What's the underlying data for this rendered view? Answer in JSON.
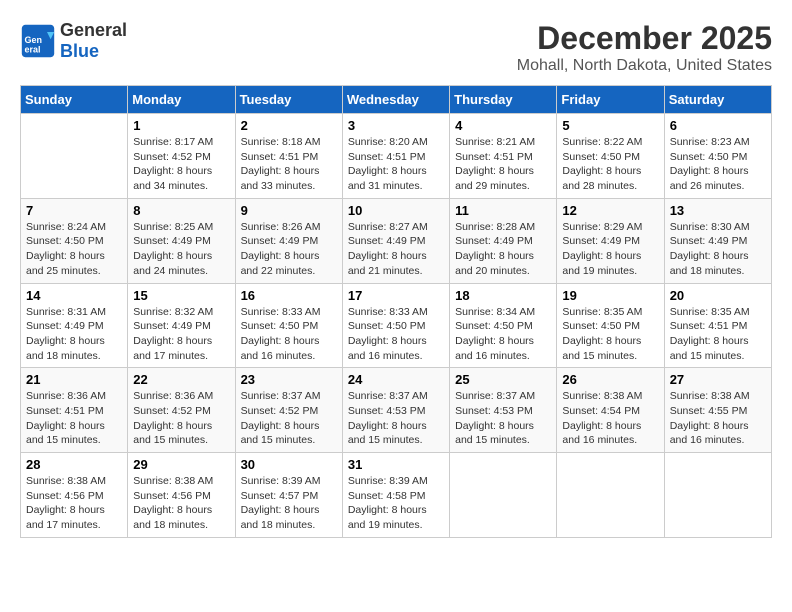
{
  "logo": {
    "general": "General",
    "blue": "Blue"
  },
  "title": "December 2025",
  "subtitle": "Mohall, North Dakota, United States",
  "days_of_week": [
    "Sunday",
    "Monday",
    "Tuesday",
    "Wednesday",
    "Thursday",
    "Friday",
    "Saturday"
  ],
  "weeks": [
    [
      {
        "day": "",
        "info": ""
      },
      {
        "day": "1",
        "info": "Sunrise: 8:17 AM\nSunset: 4:52 PM\nDaylight: 8 hours\nand 34 minutes."
      },
      {
        "day": "2",
        "info": "Sunrise: 8:18 AM\nSunset: 4:51 PM\nDaylight: 8 hours\nand 33 minutes."
      },
      {
        "day": "3",
        "info": "Sunrise: 8:20 AM\nSunset: 4:51 PM\nDaylight: 8 hours\nand 31 minutes."
      },
      {
        "day": "4",
        "info": "Sunrise: 8:21 AM\nSunset: 4:51 PM\nDaylight: 8 hours\nand 29 minutes."
      },
      {
        "day": "5",
        "info": "Sunrise: 8:22 AM\nSunset: 4:50 PM\nDaylight: 8 hours\nand 28 minutes."
      },
      {
        "day": "6",
        "info": "Sunrise: 8:23 AM\nSunset: 4:50 PM\nDaylight: 8 hours\nand 26 minutes."
      }
    ],
    [
      {
        "day": "7",
        "info": "Sunrise: 8:24 AM\nSunset: 4:50 PM\nDaylight: 8 hours\nand 25 minutes."
      },
      {
        "day": "8",
        "info": "Sunrise: 8:25 AM\nSunset: 4:49 PM\nDaylight: 8 hours\nand 24 minutes."
      },
      {
        "day": "9",
        "info": "Sunrise: 8:26 AM\nSunset: 4:49 PM\nDaylight: 8 hours\nand 22 minutes."
      },
      {
        "day": "10",
        "info": "Sunrise: 8:27 AM\nSunset: 4:49 PM\nDaylight: 8 hours\nand 21 minutes."
      },
      {
        "day": "11",
        "info": "Sunrise: 8:28 AM\nSunset: 4:49 PM\nDaylight: 8 hours\nand 20 minutes."
      },
      {
        "day": "12",
        "info": "Sunrise: 8:29 AM\nSunset: 4:49 PM\nDaylight: 8 hours\nand 19 minutes."
      },
      {
        "day": "13",
        "info": "Sunrise: 8:30 AM\nSunset: 4:49 PM\nDaylight: 8 hours\nand 18 minutes."
      }
    ],
    [
      {
        "day": "14",
        "info": "Sunrise: 8:31 AM\nSunset: 4:49 PM\nDaylight: 8 hours\nand 18 minutes."
      },
      {
        "day": "15",
        "info": "Sunrise: 8:32 AM\nSunset: 4:49 PM\nDaylight: 8 hours\nand 17 minutes."
      },
      {
        "day": "16",
        "info": "Sunrise: 8:33 AM\nSunset: 4:50 PM\nDaylight: 8 hours\nand 16 minutes."
      },
      {
        "day": "17",
        "info": "Sunrise: 8:33 AM\nSunset: 4:50 PM\nDaylight: 8 hours\nand 16 minutes."
      },
      {
        "day": "18",
        "info": "Sunrise: 8:34 AM\nSunset: 4:50 PM\nDaylight: 8 hours\nand 16 minutes."
      },
      {
        "day": "19",
        "info": "Sunrise: 8:35 AM\nSunset: 4:50 PM\nDaylight: 8 hours\nand 15 minutes."
      },
      {
        "day": "20",
        "info": "Sunrise: 8:35 AM\nSunset: 4:51 PM\nDaylight: 8 hours\nand 15 minutes."
      }
    ],
    [
      {
        "day": "21",
        "info": "Sunrise: 8:36 AM\nSunset: 4:51 PM\nDaylight: 8 hours\nand 15 minutes."
      },
      {
        "day": "22",
        "info": "Sunrise: 8:36 AM\nSunset: 4:52 PM\nDaylight: 8 hours\nand 15 minutes."
      },
      {
        "day": "23",
        "info": "Sunrise: 8:37 AM\nSunset: 4:52 PM\nDaylight: 8 hours\nand 15 minutes."
      },
      {
        "day": "24",
        "info": "Sunrise: 8:37 AM\nSunset: 4:53 PM\nDaylight: 8 hours\nand 15 minutes."
      },
      {
        "day": "25",
        "info": "Sunrise: 8:37 AM\nSunset: 4:53 PM\nDaylight: 8 hours\nand 15 minutes."
      },
      {
        "day": "26",
        "info": "Sunrise: 8:38 AM\nSunset: 4:54 PM\nDaylight: 8 hours\nand 16 minutes."
      },
      {
        "day": "27",
        "info": "Sunrise: 8:38 AM\nSunset: 4:55 PM\nDaylight: 8 hours\nand 16 minutes."
      }
    ],
    [
      {
        "day": "28",
        "info": "Sunrise: 8:38 AM\nSunset: 4:56 PM\nDaylight: 8 hours\nand 17 minutes."
      },
      {
        "day": "29",
        "info": "Sunrise: 8:38 AM\nSunset: 4:56 PM\nDaylight: 8 hours\nand 18 minutes."
      },
      {
        "day": "30",
        "info": "Sunrise: 8:39 AM\nSunset: 4:57 PM\nDaylight: 8 hours\nand 18 minutes."
      },
      {
        "day": "31",
        "info": "Sunrise: 8:39 AM\nSunset: 4:58 PM\nDaylight: 8 hours\nand 19 minutes."
      },
      {
        "day": "",
        "info": ""
      },
      {
        "day": "",
        "info": ""
      },
      {
        "day": "",
        "info": ""
      }
    ]
  ]
}
